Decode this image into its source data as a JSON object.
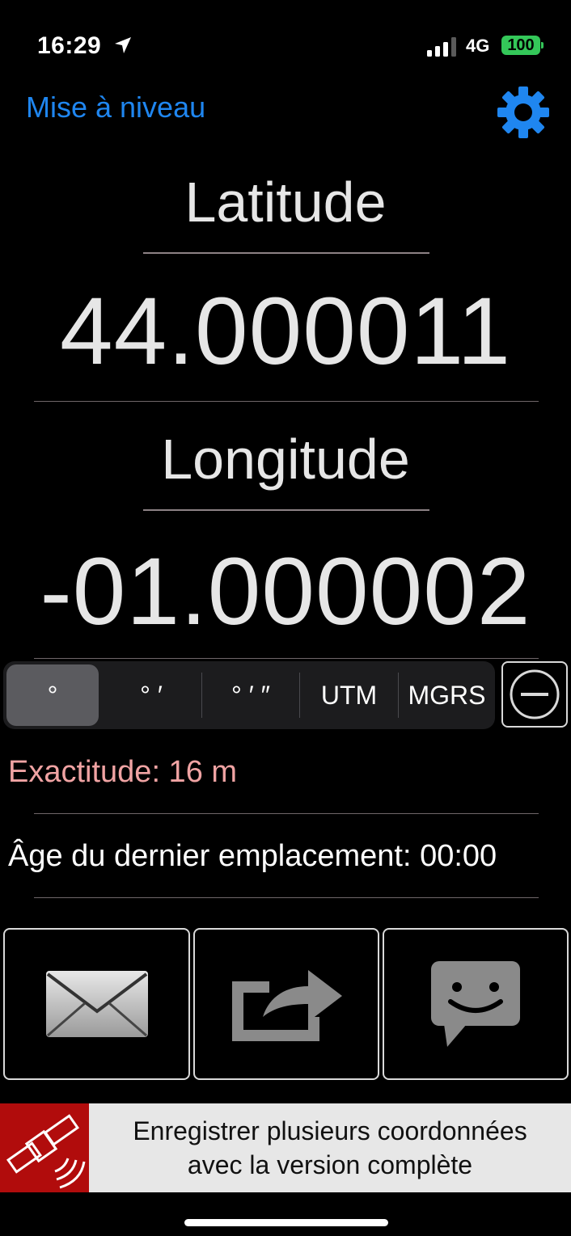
{
  "status_bar": {
    "time": "16:29",
    "network": "4G",
    "battery": "100"
  },
  "header": {
    "upgrade_link": "Mise à niveau",
    "settings_icon": "gear-icon"
  },
  "latitude": {
    "label": "Latitude",
    "value": "44.000011"
  },
  "longitude": {
    "label": "Longitude",
    "value": "-01.000002"
  },
  "format_tabs": [
    {
      "label": "°",
      "selected": true
    },
    {
      "label": "° ′",
      "selected": false
    },
    {
      "label": "° ′ ″",
      "selected": false
    },
    {
      "label": "UTM",
      "selected": false
    },
    {
      "label": "MGRS",
      "selected": false
    }
  ],
  "accuracy": "Exactitude: 16 m",
  "last_location_age": "Âge du dernier emplacement: 00:00",
  "actions": [
    {
      "icon": "mail-icon"
    },
    {
      "icon": "share-icon"
    },
    {
      "icon": "message-icon"
    }
  ],
  "banner": {
    "line1": "Enregistrer plusieurs coordonnées",
    "line2": "avec la version complète",
    "icon": "satellite-icon"
  },
  "colors": {
    "accent": "#1f86f0",
    "accuracy": "#f0a3a3",
    "banner_icon_bg": "#b10c0c",
    "battery": "#34c759"
  }
}
